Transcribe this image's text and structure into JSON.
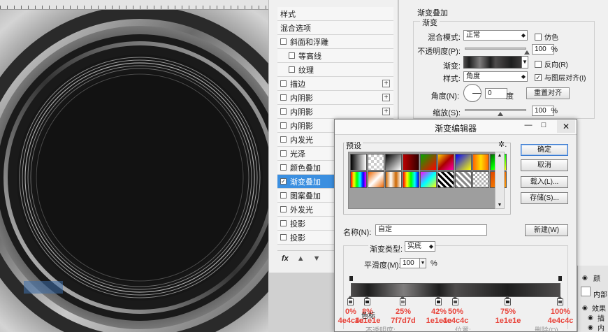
{
  "layer_style_list": {
    "items": [
      {
        "label": "样式",
        "checkbox": false,
        "plus": false,
        "indent": false,
        "selected": false
      },
      {
        "label": "混合选项",
        "checkbox": false,
        "plus": false,
        "indent": false,
        "selected": false
      },
      {
        "label": "斜面和浮雕",
        "checkbox": true,
        "checked": false,
        "plus": false,
        "indent": false,
        "selected": false
      },
      {
        "label": "等高线",
        "checkbox": true,
        "checked": false,
        "plus": false,
        "indent": true,
        "selected": false
      },
      {
        "label": "纹理",
        "checkbox": true,
        "checked": false,
        "plus": false,
        "indent": true,
        "selected": false
      },
      {
        "label": "描边",
        "checkbox": true,
        "checked": false,
        "plus": true,
        "indent": false,
        "selected": false
      },
      {
        "label": "内阴影",
        "checkbox": true,
        "checked": false,
        "plus": true,
        "indent": false,
        "selected": false
      },
      {
        "label": "内阴影",
        "checkbox": true,
        "checked": false,
        "plus": true,
        "indent": false,
        "selected": false
      },
      {
        "label": "内阴影",
        "checkbox": true,
        "checked": false,
        "plus": false,
        "indent": false,
        "selected": false
      },
      {
        "label": "内发光",
        "checkbox": true,
        "checked": false,
        "plus": false,
        "indent": false,
        "selected": false
      },
      {
        "label": "光泽",
        "checkbox": true,
        "checked": false,
        "plus": false,
        "indent": false,
        "selected": false
      },
      {
        "label": "颜色叠加",
        "checkbox": true,
        "checked": false,
        "plus": false,
        "indent": false,
        "selected": false
      },
      {
        "label": "渐变叠加",
        "checkbox": true,
        "checked": true,
        "plus": false,
        "indent": false,
        "selected": true
      },
      {
        "label": "图案叠加",
        "checkbox": true,
        "checked": false,
        "plus": false,
        "indent": false,
        "selected": false
      },
      {
        "label": "外发光",
        "checkbox": true,
        "checked": false,
        "plus": false,
        "indent": false,
        "selected": false
      },
      {
        "label": "投影",
        "checkbox": true,
        "checked": false,
        "plus": false,
        "indent": false,
        "selected": false
      },
      {
        "label": "投影",
        "checkbox": true,
        "checked": false,
        "plus": false,
        "indent": false,
        "selected": false
      }
    ],
    "fx_label": "fx",
    "up_arrow": "▲",
    "down_arrow": "▼"
  },
  "gradient_overlay": {
    "title": "渐变叠加",
    "group_label": "渐变",
    "blend_mode_label": "混合模式:",
    "blend_mode_value": "正常",
    "dither_label": "仿色",
    "opacity_label": "不透明度(P):",
    "opacity_value": "100",
    "opacity_unit": "%",
    "opacity_level": 1.0,
    "gradient_label": "渐变:",
    "reverse_label": "反向(R)",
    "style_label": "样式:",
    "style_value": "角度",
    "align_label": "与图层对齐(I)",
    "angle_label": "角度(N):",
    "angle_value": "0",
    "angle_unit": "度",
    "reset_align_label": "重置对齐",
    "scale_label": "缩放(S):",
    "scale_value": "100",
    "scale_unit": "%",
    "scale_level": 0.57
  },
  "gradient_editor": {
    "title": "渐变编辑器",
    "minimize": "—",
    "maximize": "□",
    "close": "✕",
    "presets_label": "预设",
    "gear": "✲.",
    "ok_label": "确定",
    "cancel_label": "取消",
    "load_label": "载入(L)...",
    "save_label": "存储(S)...",
    "name_label": "名称(N):",
    "name_value": "自定",
    "new_label": "新建(W)",
    "gradient_type_label": "渐变类型:",
    "gradient_type_value": "实底",
    "smoothness_label": "平滑度(M):",
    "smoothness_value": "100",
    "smoothness_unit": "%",
    "color_stop_label": "色标",
    "opacity_label": "不透明度:",
    "position_label": "位置:",
    "delete_label": "删除(D)",
    "stops": [
      {
        "percent": "0%",
        "hex": "4e4c4c",
        "pos": 0.0,
        "color": "#4e4c4c"
      },
      {
        "percent": "8%",
        "hex": "1e1e1e",
        "pos": 0.08,
        "color": "#1e1e1e"
      },
      {
        "percent": "25%",
        "hex": "7f7d7d",
        "pos": 0.25,
        "color": "#7f7d7d"
      },
      {
        "percent": "42%",
        "hex": "1e1e1e",
        "pos": 0.42,
        "color": "#1e1e1e"
      },
      {
        "percent": "50%",
        "hex": "4e4c4c",
        "pos": 0.5,
        "color": "#4e4c4c"
      },
      {
        "percent": "75%",
        "hex": "1e1e1e",
        "pos": 0.75,
        "color": "#1e1e1e"
      },
      {
        "percent": "100%",
        "hex": "4e4c4c",
        "pos": 1.0,
        "color": "#4e4c4c"
      }
    ]
  },
  "watermark_text": "",
  "layers_panel": {
    "items": [
      "颜",
      "内部",
      "效果",
      "描",
      "内"
    ]
  }
}
